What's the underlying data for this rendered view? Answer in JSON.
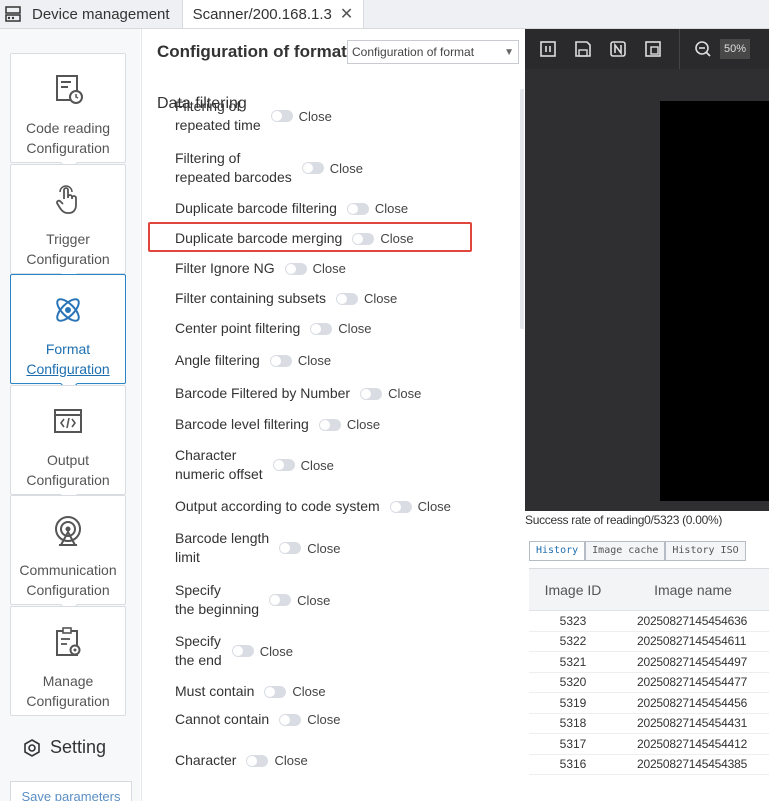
{
  "tabs": {
    "home_label": "Device management",
    "active_label": "Scanner/200.168.1.3",
    "close_glyph": "✕"
  },
  "sidebar": {
    "items": [
      {
        "line1": "Code reading",
        "line2": "Configuration",
        "icon": "code-reading-icon"
      },
      {
        "line1": "Trigger",
        "line2": "Configuration",
        "icon": "trigger-hand-icon"
      },
      {
        "line1": "Format",
        "line2": "Configuration",
        "icon": "format-atom-icon"
      },
      {
        "line1": "Output",
        "line2": "Configuration",
        "icon": "output-code-icon"
      },
      {
        "line1": "Communication",
        "line2": "Configuration",
        "icon": "communication-icon"
      },
      {
        "line1": "Manage",
        "line2": "Configuration",
        "icon": "manage-icon"
      }
    ],
    "setting_label": "Setting",
    "save_label": "Save parameters",
    "accent_color": "#2a84c8"
  },
  "config": {
    "title": "Configuration of format",
    "select_value": "Configuration of format",
    "section_title": "Data filtering",
    "toggle_state": "Close",
    "rows": [
      {
        "l1": "Filtering of",
        "l2": "repeated time"
      },
      {
        "l1": "Filtering of",
        "l2": "repeated barcodes"
      },
      {
        "l1": "Duplicate barcode filtering",
        "l2": ""
      },
      {
        "l1": "Duplicate barcode merging",
        "l2": ""
      },
      {
        "l1": "Filter Ignore NG",
        "l2": ""
      },
      {
        "l1": "Filter containing subsets",
        "l2": ""
      },
      {
        "l1": "Center point filtering",
        "l2": ""
      },
      {
        "l1": "Angle filtering",
        "l2": ""
      },
      {
        "l1": "Barcode Filtered by Number",
        "l2": ""
      },
      {
        "l1": "Barcode level filtering",
        "l2": ""
      },
      {
        "l1": "Character",
        "l2": "numeric offset"
      },
      {
        "l1": "Output according to code system",
        "l2": ""
      },
      {
        "l1": "Barcode length",
        "l2": "limit"
      },
      {
        "l1": "Specify",
        "l2": "the beginning"
      },
      {
        "l1": "Specify",
        "l2": "the end"
      },
      {
        "l1": "Must contain",
        "l2": ""
      },
      {
        "l1": "Cannot contain",
        "l2": ""
      },
      {
        "l1": "Character",
        "l2": ""
      }
    ],
    "highlight_color": "#e0463c"
  },
  "viewer": {
    "zoom_label": "50%",
    "success_text": "Success rate of reading0/5323 (0.00%)",
    "subtabs": [
      "History",
      "Image cache",
      "History ISO"
    ],
    "table_headers": {
      "id": "Image ID",
      "name": "Image name"
    },
    "table_rows": [
      {
        "id": "5323",
        "name": "20250827145454636"
      },
      {
        "id": "5322",
        "name": "20250827145454611"
      },
      {
        "id": "5321",
        "name": "20250827145454497"
      },
      {
        "id": "5320",
        "name": "20250827145454477"
      },
      {
        "id": "5319",
        "name": "20250827145454456"
      },
      {
        "id": "5318",
        "name": "20250827145454431"
      },
      {
        "id": "5317",
        "name": "20250827145454412"
      },
      {
        "id": "5316",
        "name": "20250827145454385"
      }
    ]
  }
}
